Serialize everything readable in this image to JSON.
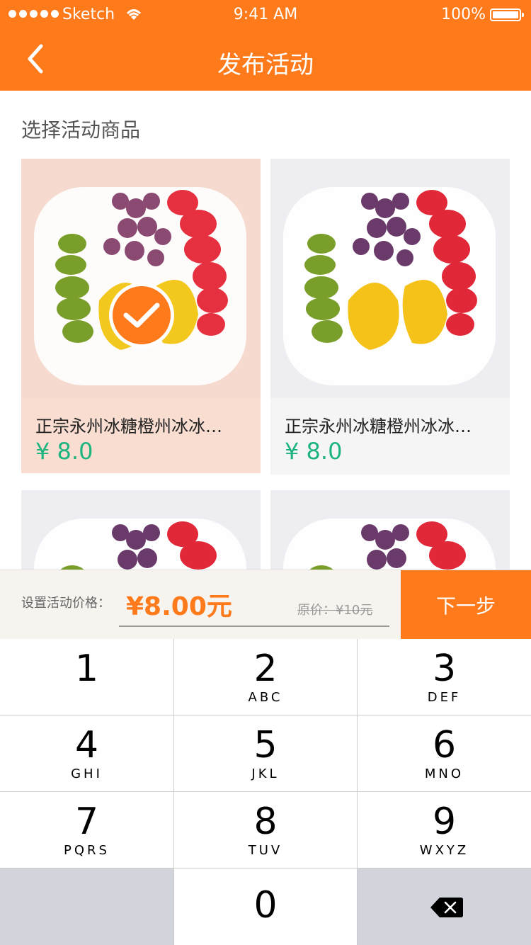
{
  "status": {
    "carrier": "Sketch",
    "time": "9:41 AM",
    "battery": "100%"
  },
  "nav": {
    "title": "发布活动",
    "back_icon": "chevron-left-icon"
  },
  "section_title": "选择活动商品",
  "products": [
    {
      "title": "正宗永州冰糖橙州冰冰…",
      "price": "¥ 8.0",
      "selected": true
    },
    {
      "title": "正宗永州冰糖橙州冰冰…",
      "price": "¥ 8.0",
      "selected": false
    },
    {
      "title": "",
      "price": "",
      "selected": false
    },
    {
      "title": "",
      "price": "",
      "selected": false
    }
  ],
  "price_bar": {
    "label": "设置活动价格：",
    "value": "¥8.00元",
    "original": "原价：¥10元",
    "next": "下一步"
  },
  "keypad": [
    {
      "num": "1",
      "letters": ""
    },
    {
      "num": "2",
      "letters": "ABC"
    },
    {
      "num": "3",
      "letters": "DEF"
    },
    {
      "num": "4",
      "letters": "GHI"
    },
    {
      "num": "5",
      "letters": "JKL"
    },
    {
      "num": "6",
      "letters": "MNO"
    },
    {
      "num": "7",
      "letters": "PQRS"
    },
    {
      "num": "8",
      "letters": "TUV"
    },
    {
      "num": "9",
      "letters": "WXYZ"
    },
    {
      "num": "0",
      "letters": ""
    }
  ],
  "colors": {
    "accent": "#FF7A1A",
    "price_green": "#1DB47F",
    "selected_bg": "#F8DDD0"
  }
}
